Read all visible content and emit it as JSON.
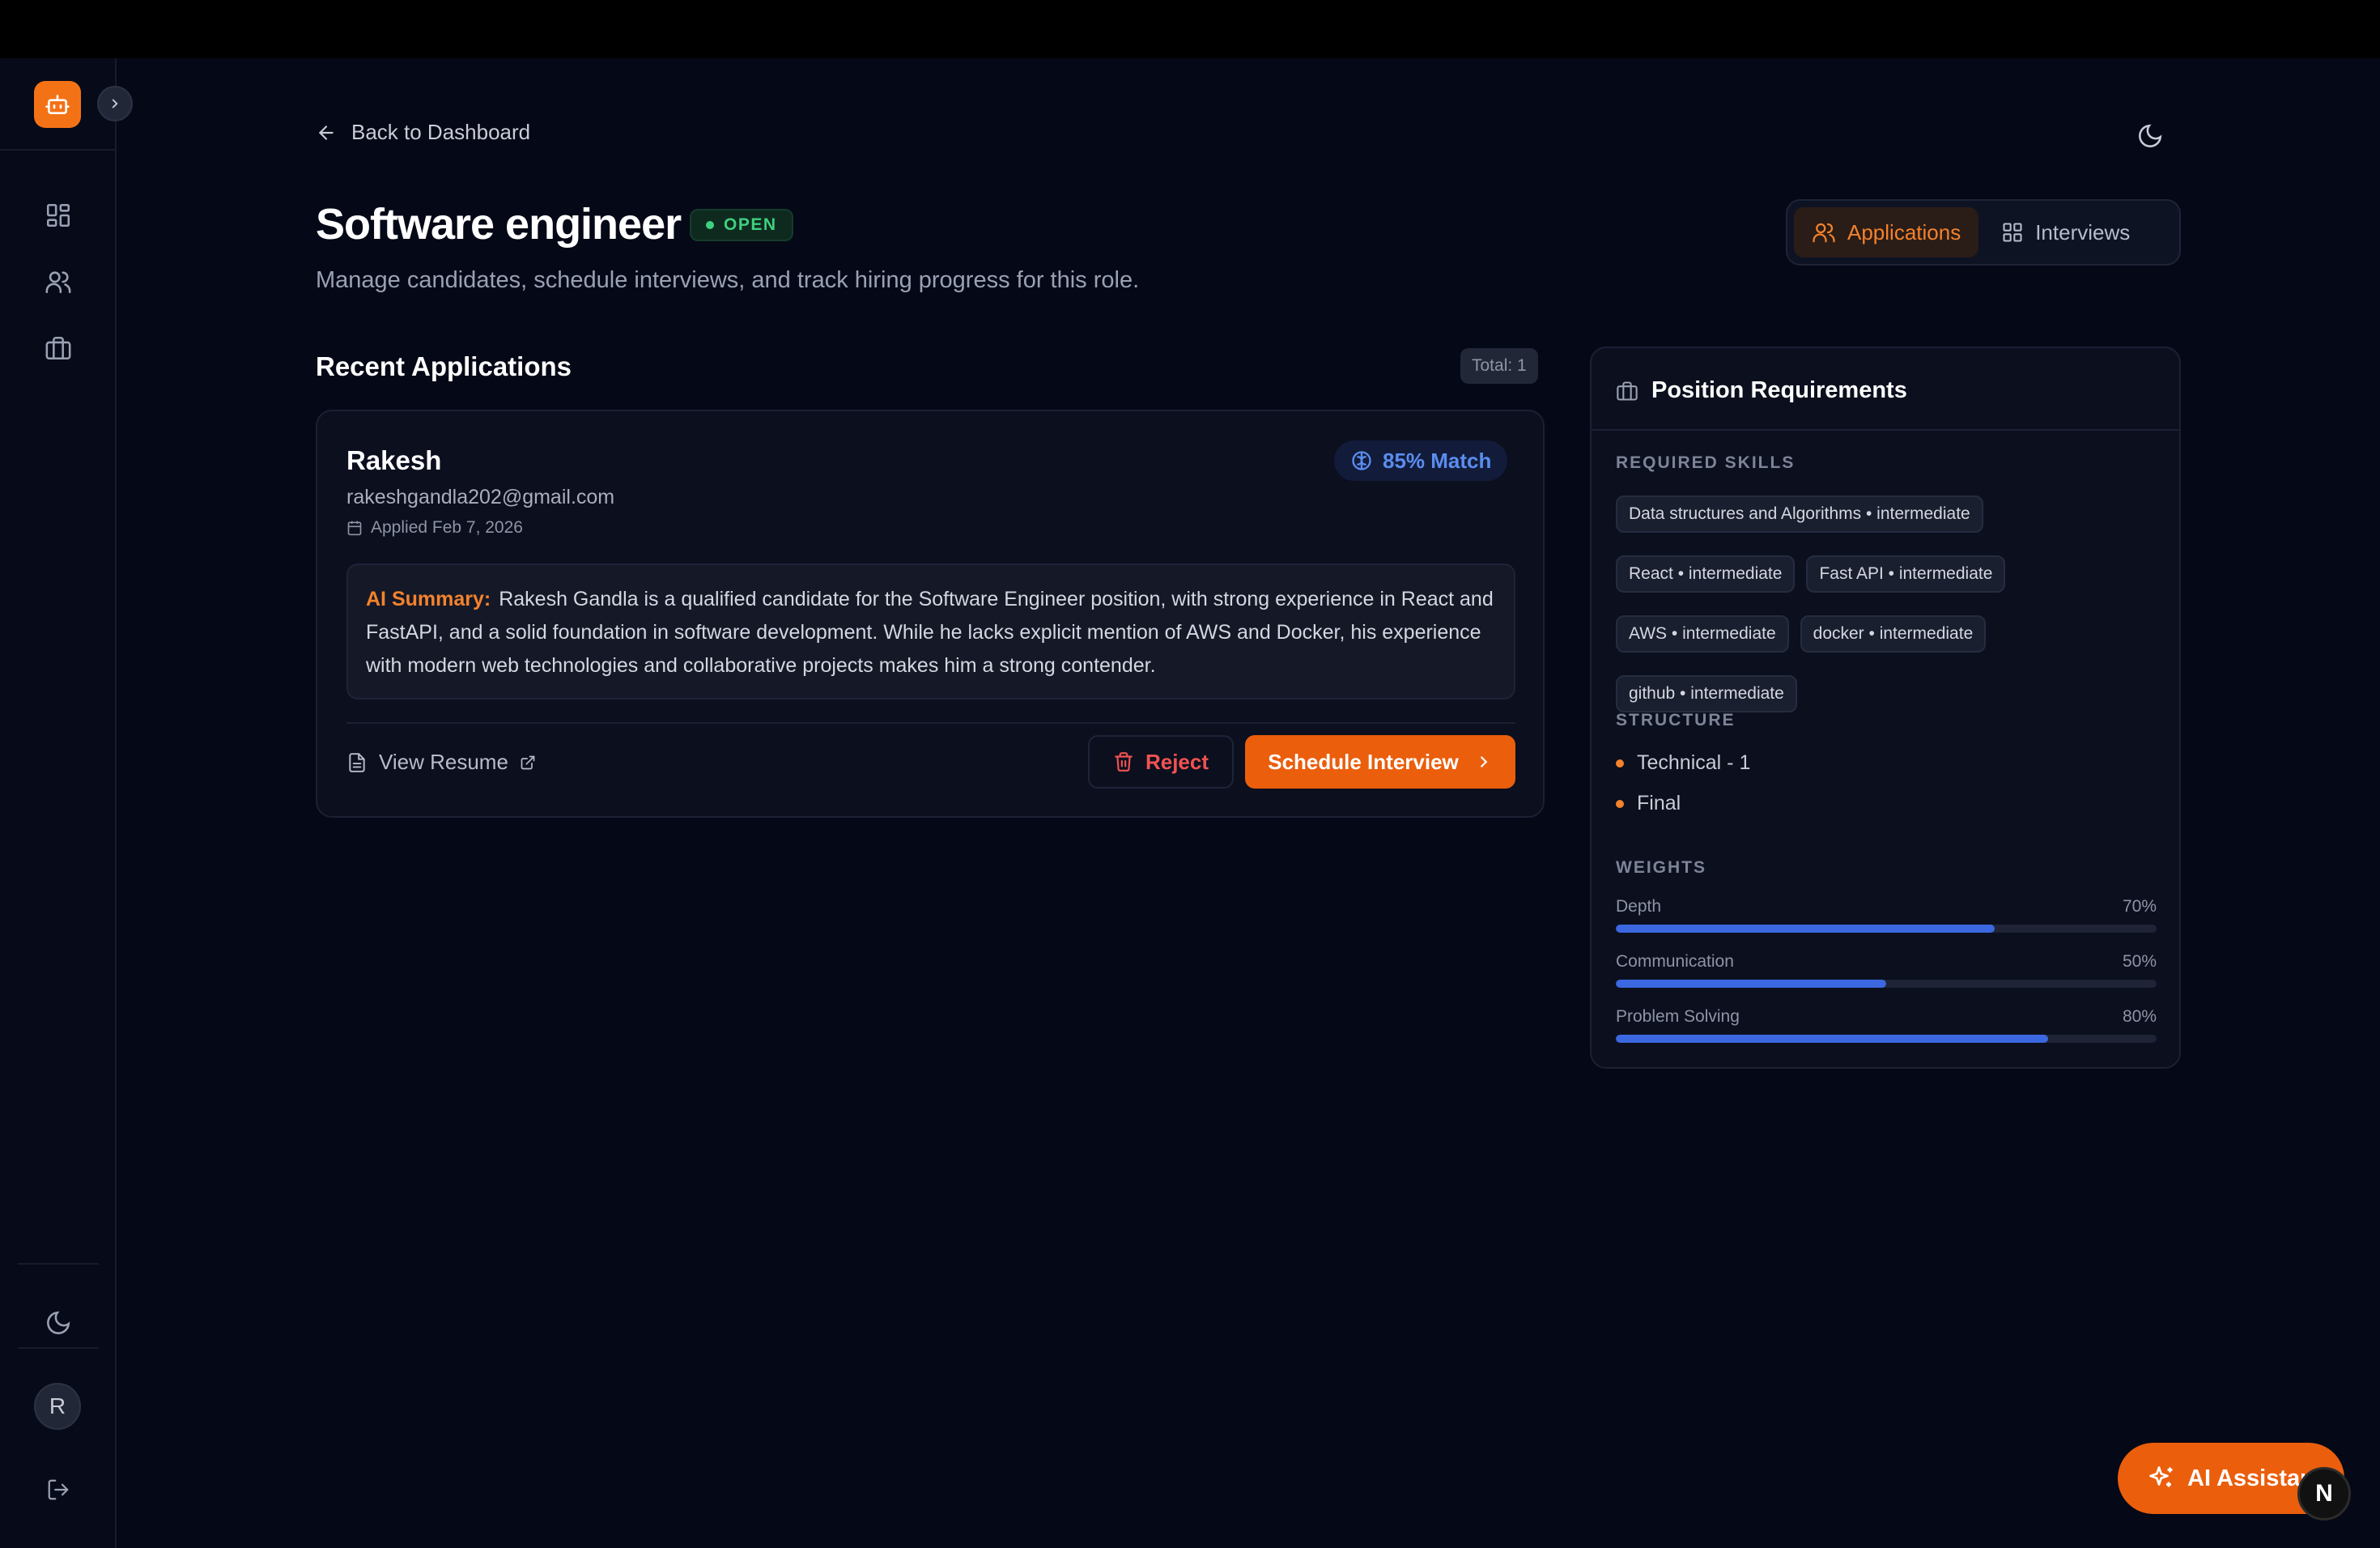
{
  "sidebar": {
    "avatar_initial": "R"
  },
  "header": {
    "back_label": "Back to Dashboard",
    "title": "Software engineer",
    "status": "OPEN",
    "subtitle": "Manage candidates, schedule interviews, and track hiring progress for this role."
  },
  "tabs": [
    {
      "label": "Applications",
      "active": true
    },
    {
      "label": "Interviews",
      "active": false
    }
  ],
  "applications": {
    "title": "Recent Applications",
    "total_label": "Total: 1",
    "candidate": {
      "name": "Rakesh",
      "email": "rakeshgandla202@gmail.com",
      "applied": "Applied Feb 7, 2026",
      "match": "85% Match",
      "summary_label": "AI Summary:",
      "summary": "Rakesh Gandla is a qualified candidate for the Software Engineer position, with strong experience in React and FastAPI, and a solid foundation in software development. While he lacks explicit mention of AWS and Docker, his experience with modern web technologies and collaborative projects makes him a strong contender.",
      "view_resume": "View Resume",
      "reject": "Reject",
      "schedule": "Schedule Interview"
    }
  },
  "requirements": {
    "title": "Position Requirements",
    "skills_label": "REQUIRED SKILLS",
    "skills": [
      "Data structures and Algorithms • intermediate",
      "React • intermediate",
      "Fast API • intermediate",
      "AWS • intermediate",
      "docker • intermediate",
      "github • intermediate"
    ],
    "structure_label": "STRUCTURE",
    "structure": [
      "Technical - 1",
      "Final"
    ],
    "weights_label": "WEIGHTS",
    "weights": [
      {
        "name": "Depth",
        "label": "70%",
        "value": 0.7
      },
      {
        "name": "Communication",
        "label": "50%",
        "value": 0.5
      },
      {
        "name": "Problem Solving",
        "label": "80%",
        "value": 0.8
      }
    ]
  },
  "assistant": {
    "label": "AI Assistant",
    "n_badge": "N"
  },
  "colors": {
    "accent": "#ea5e0c",
    "match_blue": "#5b8def",
    "weight_blue": "#3b68e0",
    "open_green": "#3ecf7e",
    "reject_red": "#f05252"
  }
}
